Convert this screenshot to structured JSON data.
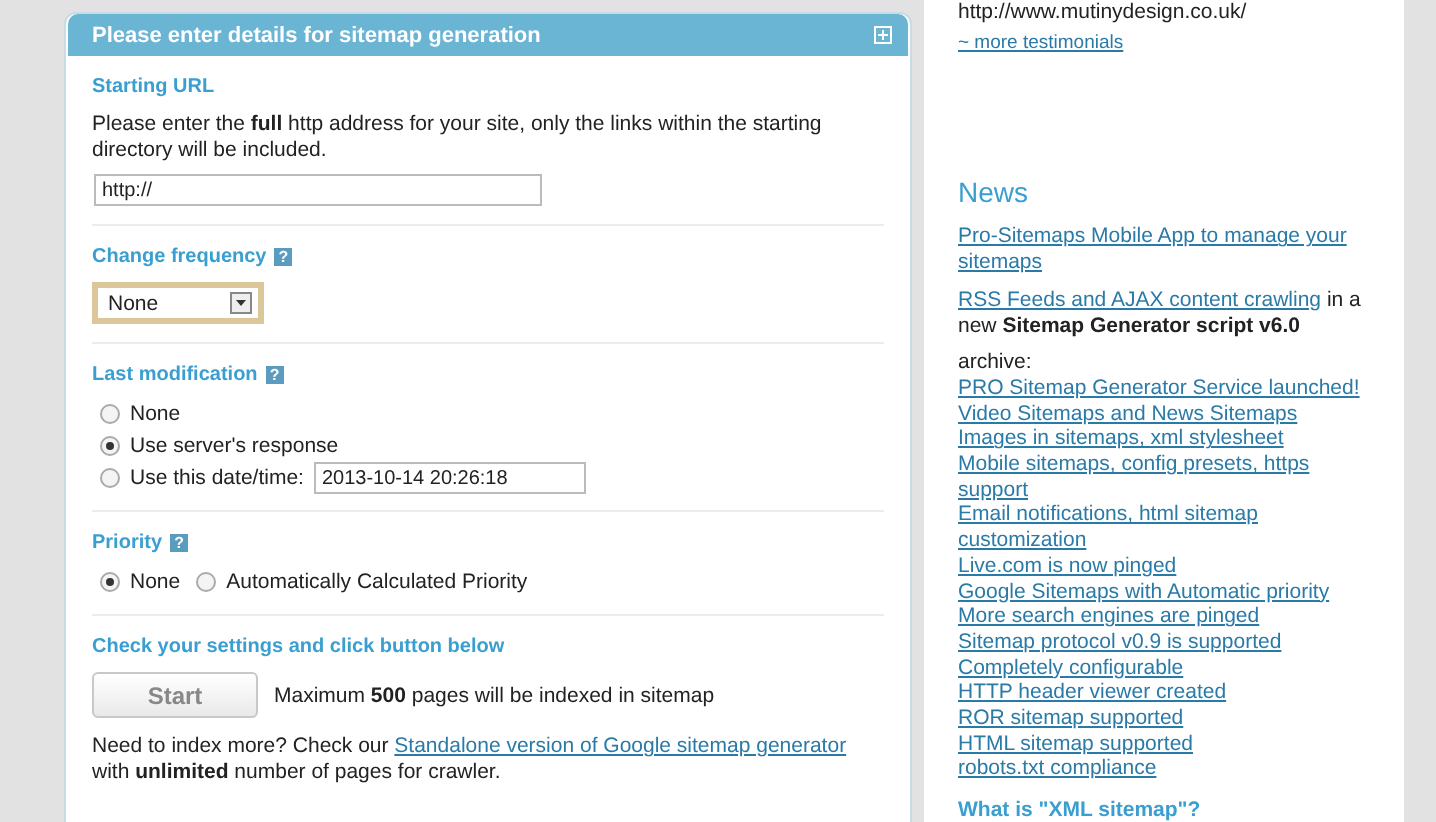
{
  "form": {
    "title": "Please enter details for sitemap generation",
    "starting_url": {
      "label": "Starting URL",
      "description": "Please enter the **full** http address for your site, only the links within the starting directory will be included.",
      "value": "http://"
    },
    "change_frequency": {
      "label": "Change frequency",
      "help": "?",
      "value": "None"
    },
    "last_modification": {
      "label": "Last modification",
      "help": "?",
      "options": [
        {
          "label": "None",
          "selected": false
        },
        {
          "label": "Use server's response",
          "selected": true,
          "kind": "plain"
        },
        {
          "label": "Use this date/time:",
          "selected": false,
          "kind": "datetime",
          "value": "2013-10-14 20:26:18"
        }
      ]
    },
    "priority": {
      "label": "Priority",
      "help": "?",
      "options": [
        {
          "label": "None",
          "selected": true
        },
        {
          "label": "Automatically Calculated Priority",
          "selected": false
        }
      ]
    },
    "submit": {
      "label": "Check your settings and click button below",
      "button": "Start",
      "note": "Maximum **500** pages will be indexed in sitemap",
      "more_before": "Need to index more? Check our",
      "more_link": "Standalone version of Google sitemap generator",
      "more_after": "with **unlimited** number of pages for crawler."
    }
  },
  "sidebar": {
    "testimonial_url": "http://www.mutinydesign.co.uk/",
    "more_testimonials": "~ more testimonials",
    "news_title": "News",
    "news": [
      {
        "link": "Pro-Sitemaps Mobile App to manage your sitemaps"
      },
      {
        "link": "RSS Feeds and AJAX content crawling",
        "after": "in a new **Sitemap Generator script v6.0**"
      }
    ],
    "archive_label": "archive:",
    "archive": [
      "PRO Sitemap Generator Service launched!",
      "Video Sitemaps and News Sitemaps",
      "Images in sitemaps, xml stylesheet",
      "Mobile sitemaps, config presets, https support",
      "Email notifications, html sitemap customization",
      "Live.com is now pinged",
      "Google Sitemaps with Automatic priority",
      "More search engines are pinged",
      "Sitemap protocol v0.9 is supported",
      "Completely configurable",
      "HTTP header viewer created",
      "ROR sitemap supported",
      "HTML sitemap supported",
      "robots.txt compliance"
    ],
    "what_is": "What is \"XML sitemap\"?"
  }
}
